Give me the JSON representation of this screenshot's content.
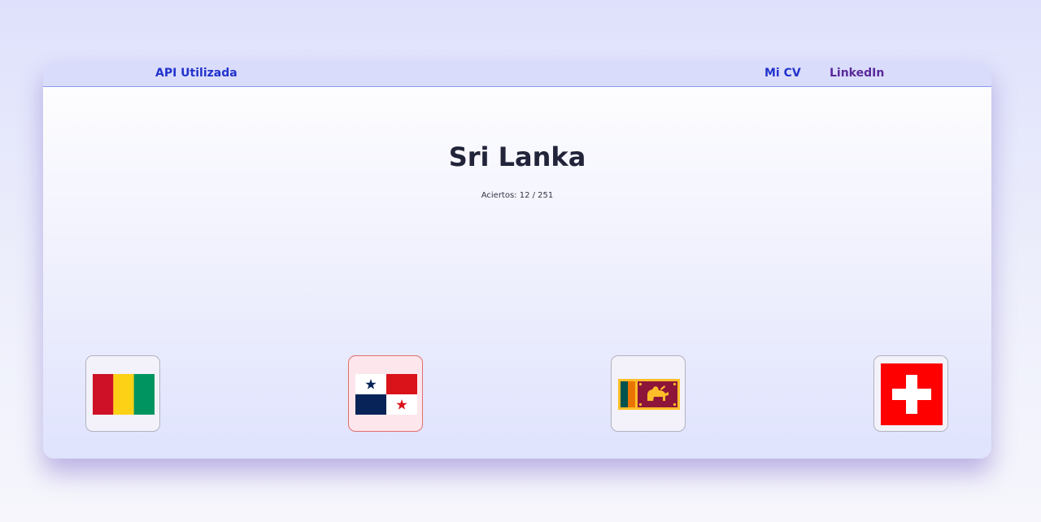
{
  "nav": {
    "api_label": "API Utilizada",
    "cv_label": "Mi CV",
    "linkedin_label": "LinkedIn"
  },
  "quiz": {
    "country_name": "Sri Lanka",
    "score_text": "Aciertos: 12 / 251"
  },
  "options": [
    {
      "flag": "guinea-flag",
      "state": "default"
    },
    {
      "flag": "panama-flag",
      "state": "wrong"
    },
    {
      "flag": "sri-lanka-flag",
      "state": "default"
    },
    {
      "flag": "switzerland-flag",
      "state": "default"
    }
  ],
  "colors": {
    "nav_link": "#2233cc",
    "nav_link_visited": "#5a2a9a",
    "title": "#22243a",
    "wrong_border": "#e07070",
    "wrong_bg": "#fde6ec"
  }
}
